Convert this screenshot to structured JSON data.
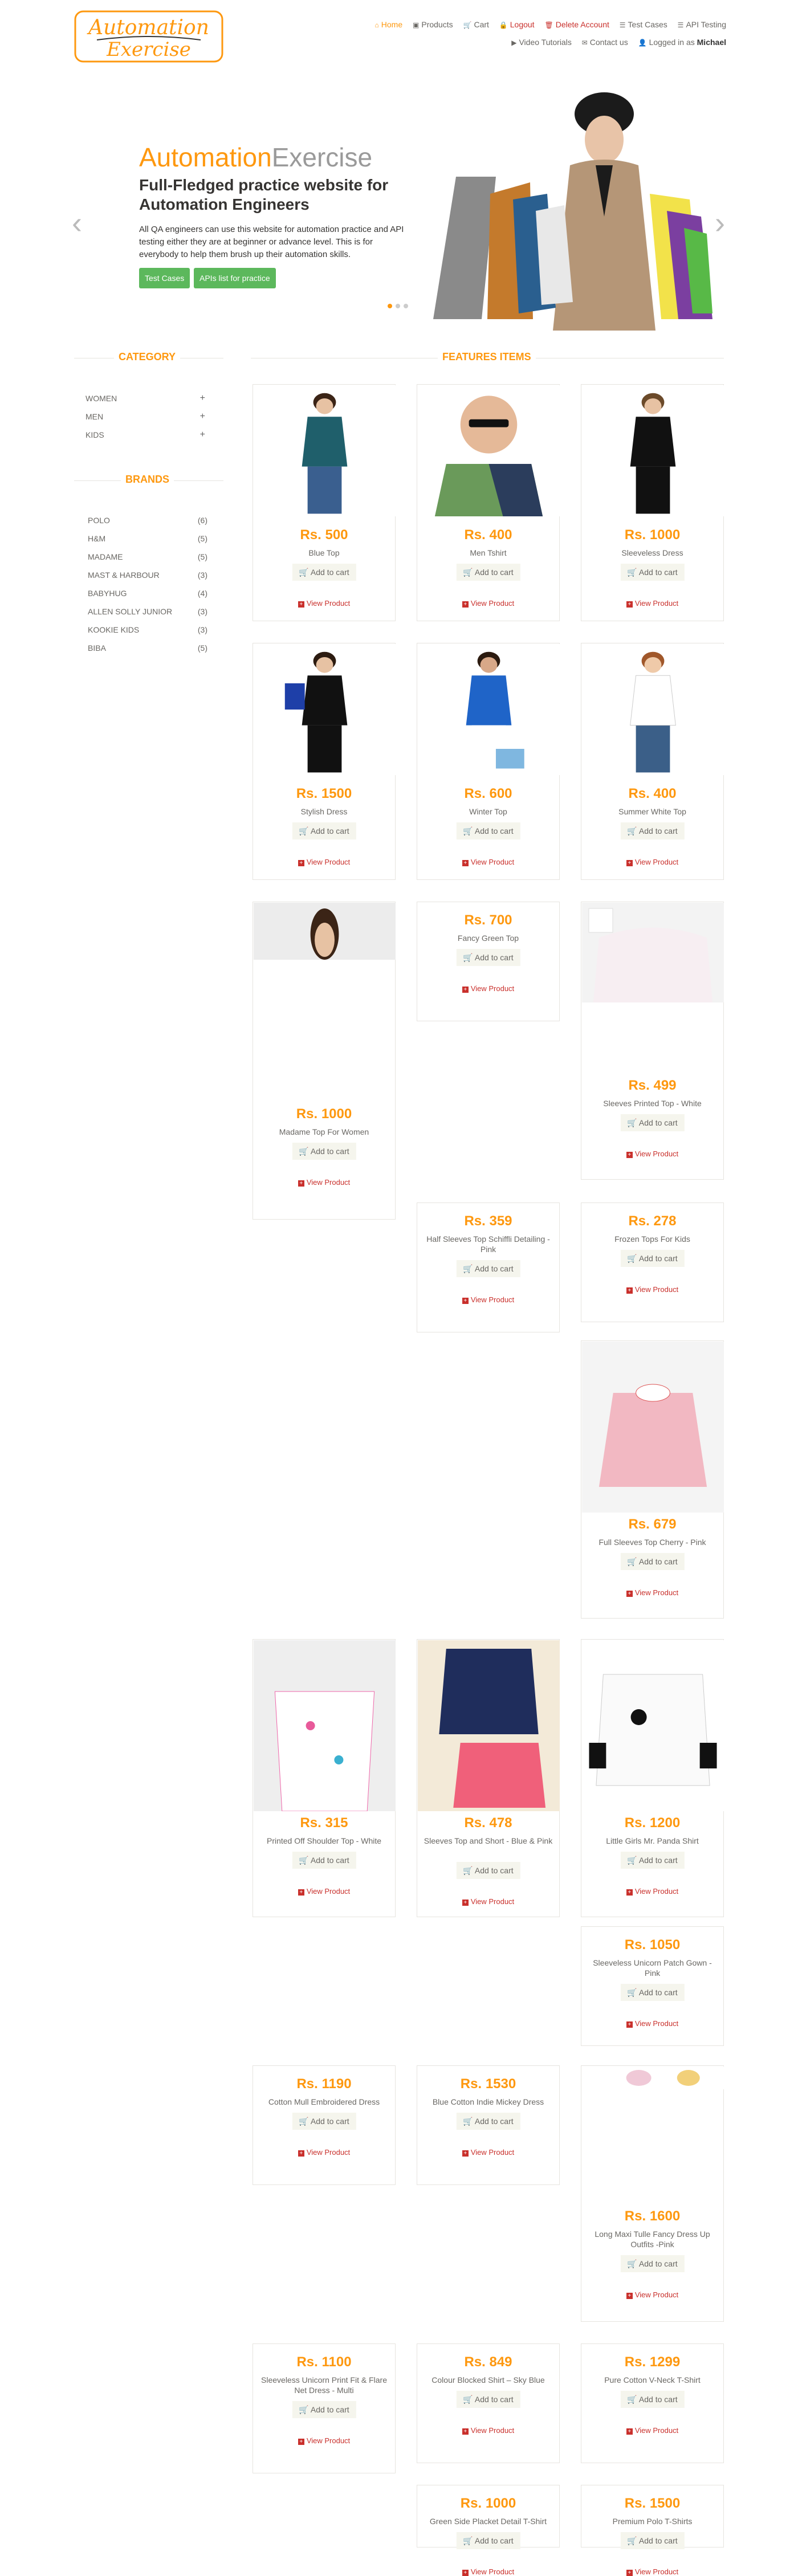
{
  "logo": {
    "line1": "Automation",
    "line2": "Exercise"
  },
  "nav": {
    "home": "Home",
    "products": "Products",
    "cart": "Cart",
    "logout": "Logout",
    "delete": "Delete Account",
    "test_cases": "Test Cases",
    "api_testing": "API Testing",
    "video": "Video Tutorials",
    "contact": "Contact us",
    "logged_in": "Logged in as",
    "user": "Michael"
  },
  "hero": {
    "brand1": "Automation",
    "brand2": "Exercise",
    "heading": "Full-Fledged practice website for Automation Engineers",
    "text": "All QA engineers can use this website for automation practice and API testing either they are at beginner or advance level. This is for everybody to help them brush up their automation skills.",
    "btn1": "Test Cases",
    "btn2": "APIs list for practice",
    "prev": "‹",
    "next": "›"
  },
  "sidebar": {
    "category_title": "CATEGORY",
    "categories": [
      "WOMEN",
      "MEN",
      "KIDS"
    ],
    "plus": "+",
    "brands_title": "BRANDS",
    "brands": [
      {
        "name": "POLO",
        "count": "(6)"
      },
      {
        "name": "H&M",
        "count": "(5)"
      },
      {
        "name": "MADAME",
        "count": "(5)"
      },
      {
        "name": "MAST & HARBOUR",
        "count": "(3)"
      },
      {
        "name": "BABYHUG",
        "count": "(4)"
      },
      {
        "name": "ALLEN SOLLY JUNIOR",
        "count": "(3)"
      },
      {
        "name": "KOOKIE KIDS",
        "count": "(3)"
      },
      {
        "name": "BIBA",
        "count": "(5)"
      }
    ]
  },
  "features_title": "FEATURES ITEMS",
  "add_to_cart": "Add to cart",
  "view_product": "View Product",
  "products": [
    {
      "price": "Rs. 500",
      "name": "Blue Top"
    },
    {
      "price": "Rs. 400",
      "name": "Men Tshirt"
    },
    {
      "price": "Rs. 1000",
      "name": "Sleeveless Dress"
    },
    {
      "price": "Rs. 1500",
      "name": "Stylish Dress"
    },
    {
      "price": "Rs. 600",
      "name": "Winter Top"
    },
    {
      "price": "Rs. 400",
      "name": "Summer White Top"
    },
    {
      "price": "Rs. 1000",
      "name": "Madame Top For Women"
    },
    {
      "price": "Rs. 700",
      "name": "Fancy Green Top"
    },
    {
      "price": "Rs. 499",
      "name": "Sleeves Printed Top - White"
    },
    {
      "price": "Rs. 359",
      "name": "Half Sleeves Top Schiffli Detailing - Pink"
    },
    {
      "price": "Rs. 278",
      "name": "Frozen Tops For Kids"
    },
    {
      "price": "Rs. 679",
      "name": "Full Sleeves Top Cherry - Pink"
    },
    {
      "price": "Rs. 315",
      "name": "Printed Off Shoulder Top - White"
    },
    {
      "price": "Rs. 478",
      "name": "Sleeves Top and Short - Blue & Pink"
    },
    {
      "price": "Rs. 1200",
      "name": "Little Girls Mr. Panda Shirt"
    },
    {
      "price": "Rs. 1050",
      "name": "Sleeveless Unicorn Patch Gown - Pink"
    },
    {
      "price": "Rs. 1190",
      "name": "Cotton Mull Embroidered Dress"
    },
    {
      "price": "Rs. 1530",
      "name": "Blue Cotton Indie Mickey Dress"
    },
    {
      "price": "Rs. 1600",
      "name": "Long Maxi Tulle Fancy Dress Up Outfits -Pink"
    },
    {
      "price": "Rs. 1100",
      "name": "Sleeveless Unicorn Print Fit & Flare Net Dress - Multi"
    },
    {
      "price": "Rs. 849",
      "name": "Colour Blocked Shirt – Sky Blue"
    },
    {
      "price": "Rs. 1299",
      "name": "Pure Cotton V-Neck T-Shirt"
    },
    {
      "price": "Rs. 1000",
      "name": "Green Side Placket Detail T-Shirt"
    },
    {
      "price": "Rs. 1500",
      "name": "Premium Polo T-Shirts"
    }
  ]
}
